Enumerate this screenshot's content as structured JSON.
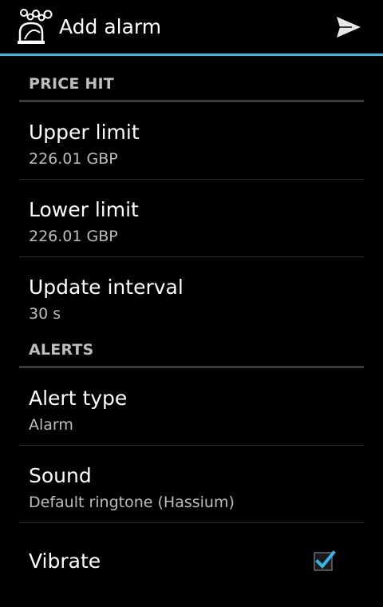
{
  "action_bar": {
    "title": "Add alarm",
    "app_icon": "alarm-bell-app-icon",
    "send_icon": "send-icon",
    "accent_color": "#33b5e5"
  },
  "sections": [
    {
      "header": "PRICE HIT",
      "items": [
        {
          "title": "Upper limit",
          "summary": "226.01 GBP"
        },
        {
          "title": "Lower limit",
          "summary": "226.01 GBP"
        },
        {
          "title": "Update interval",
          "summary": "30 s"
        }
      ]
    },
    {
      "header": "ALERTS",
      "items": [
        {
          "title": "Alert type",
          "summary": "Alarm"
        },
        {
          "title": "Sound",
          "summary": "Default ringtone (Hassium)"
        }
      ]
    }
  ],
  "vibrate": {
    "title": "Vibrate",
    "checked": true
  }
}
